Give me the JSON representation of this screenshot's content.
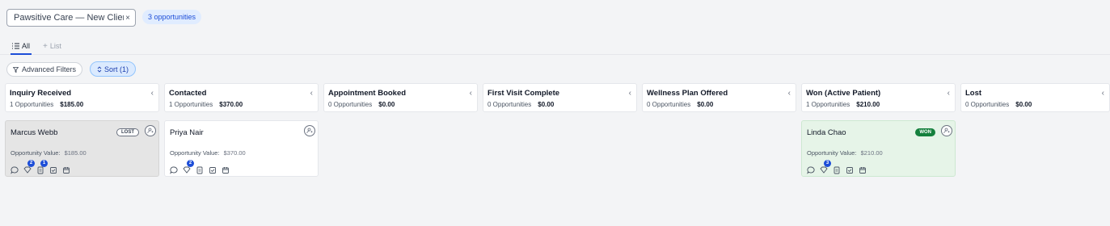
{
  "toolbar": {
    "pipeline_value": "Pawsitive Care — New Client Pipeline",
    "clear_symbol": "×",
    "opportunity_count": "3 opportunities"
  },
  "tabs": [
    {
      "label": "All",
      "icon": "list-icon",
      "active": true
    },
    {
      "label": "List",
      "icon": "plus-icon",
      "active": false
    }
  ],
  "filters": {
    "advanced_label": "Advanced Filters",
    "sort_label": "Sort (1)"
  },
  "columns": [
    {
      "name": "Inquiry Received",
      "count": "1 Opportunities",
      "value": "$185.00"
    },
    {
      "name": "Contacted",
      "count": "1 Opportunities",
      "value": "$370.00"
    },
    {
      "name": "Appointment Booked",
      "count": "0 Opportunities",
      "value": "$0.00"
    },
    {
      "name": "First Visit Complete",
      "count": "0 Opportunities",
      "value": "$0.00"
    },
    {
      "name": "Wellness Plan Offered",
      "count": "0 Opportunities",
      "value": "$0.00"
    },
    {
      "name": "Won (Active Patient)",
      "count": "1 Opportunities",
      "value": "$210.00"
    },
    {
      "name": "Lost",
      "count": "0 Opportunities",
      "value": "$0.00"
    }
  ],
  "collapse_symbol": "‹",
  "cards": [
    {
      "name": "Marcus Webb",
      "status": "LOST",
      "value_label": "Opportunity Value:",
      "value": "$185.00",
      "badges": {
        "tasks": "2",
        "notes": "1"
      },
      "style": "lost"
    },
    {
      "name": "Priya Nair",
      "status": "",
      "value_label": "Opportunity Value:",
      "value": "$370.00",
      "badges": {
        "tasks": "2"
      },
      "style": "open"
    },
    {
      "name": "Linda Chao",
      "status": "WON",
      "value_label": "Opportunity Value:",
      "value": "$210.00",
      "badges": {
        "tasks": "3"
      },
      "style": "won"
    }
  ],
  "colors": {
    "accent": "#1d4ed8",
    "won": "#15803d",
    "lost_bg": "#e5e5e5",
    "won_bg": "#e6f4e8"
  }
}
